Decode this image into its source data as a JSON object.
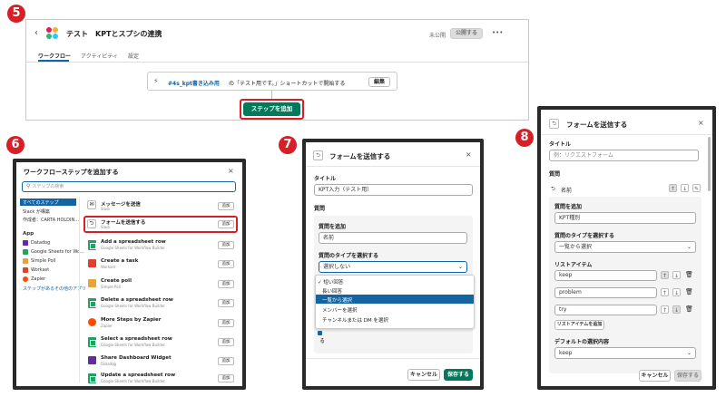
{
  "badges": [
    "5",
    "6",
    "7",
    "8"
  ],
  "panel5": {
    "title": "テスト　KPTとスプシの連携",
    "status": "未公開",
    "publish": "公開する",
    "more": "•••",
    "tabs": [
      "ワークフロー",
      "アクティビティ",
      "設定"
    ],
    "trigger_channel": "#4s_kpt書き込み用",
    "trigger_text": "の「テスト用です。」ショートカットで開始する",
    "edit": "編集",
    "add_step": "ステップを追加"
  },
  "panel6": {
    "title": "ワークフローステップを追加する",
    "search_placeholder": "ステップの検索",
    "sidebar": [
      "すべてのステップ",
      "Slack が構築",
      "作成者：CARTA HOLDIN..."
    ],
    "app_header": "App",
    "apps": [
      "Datadog",
      "Google Sheets for Wo...",
      "Simple Poll",
      "Workast",
      "Zapier"
    ],
    "see_all": "ステップがあるその他のアプリ",
    "items": [
      {
        "title": "メッセージを送信",
        "sub": "Slack"
      },
      {
        "title": "フォームを送信する",
        "sub": "Slack"
      },
      {
        "title": "Add a spreadsheet row",
        "sub": "Google Sheets for Workflow Builder"
      },
      {
        "title": "Create a task",
        "sub": "Workast"
      },
      {
        "title": "Create poll",
        "sub": "Simple Poll"
      },
      {
        "title": "Delete a spreadsheet row",
        "sub": "Google Sheets for Workflow Builder"
      },
      {
        "title": "More Steps by Zapier",
        "sub": "Zapier"
      },
      {
        "title": "Select a spreadsheet row",
        "sub": "Google Sheets for Workflow Builder"
      },
      {
        "title": "Share Dashboard Widget",
        "sub": "Datadog"
      },
      {
        "title": "Update a spreadsheet row",
        "sub": "Google Sheets for Workflow Builder"
      }
    ],
    "add": "追加"
  },
  "panel7": {
    "title": "フォームを送信する",
    "title_label": "タイトル",
    "title_value": "KPT入力（テスト用）",
    "questions_label": "質問",
    "add_q_label": "質問を追加",
    "add_q_value": "名前",
    "type_label": "質問のタイプを選択する",
    "type_value": "選択しない",
    "options": [
      "短い回答",
      "長い回答",
      "一覧から選択",
      "メンバーを選択",
      "チャンネルまたは DM を選択"
    ],
    "check_char": "る",
    "cancel": "キャンセル",
    "save": "保存する"
  },
  "panel8": {
    "title": "フォームを送信する",
    "title_label": "タイトル",
    "title_placeholder": "例：リクエストフォーム",
    "questions_label": "質問",
    "q_name": "名前",
    "add_q_label": "質問を追加",
    "add_q_value": "KPT種別",
    "type_label": "質問のタイプを選択する",
    "type_value": "一覧から選択",
    "list_label": "リストアイテム",
    "list_items": [
      "keep",
      "problem",
      "try"
    ],
    "add_list": "リストアイテムを追加",
    "default_label": "デフォルトの選択内容",
    "default_value": "keep",
    "cancel": "キャンセル",
    "save": "保存する"
  }
}
